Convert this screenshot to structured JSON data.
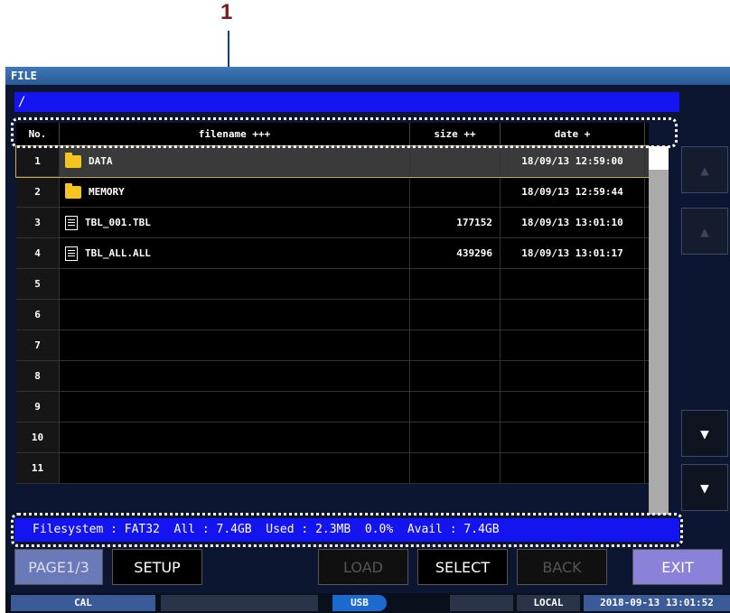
{
  "callout": {
    "number": "1"
  },
  "window": {
    "title": "FILE"
  },
  "path": "/",
  "table": {
    "headers": {
      "no": "No.",
      "filename": "filename +++",
      "size": "size ++",
      "date": "date +"
    },
    "rows": [
      {
        "no": "1",
        "icon": "folder-icon",
        "name": "DATA",
        "size": "",
        "date": "18/09/13 12:59:00",
        "selected": true
      },
      {
        "no": "2",
        "icon": "folder-icon",
        "name": "MEMORY",
        "size": "",
        "date": "18/09/13 12:59:44"
      },
      {
        "no": "3",
        "icon": "file-icon",
        "name": "TBL_001.TBL",
        "size": "177152",
        "date": "18/09/13 13:01:10"
      },
      {
        "no": "4",
        "icon": "file-icon",
        "name": "TBL_ALL.ALL",
        "size": "439296",
        "date": "18/09/13 13:01:17"
      },
      {
        "no": "5",
        "icon": "",
        "name": "",
        "size": "",
        "date": ""
      },
      {
        "no": "6",
        "icon": "",
        "name": "",
        "size": "",
        "date": ""
      },
      {
        "no": "7",
        "icon": "",
        "name": "",
        "size": "",
        "date": ""
      },
      {
        "no": "8",
        "icon": "",
        "name": "",
        "size": "",
        "date": ""
      },
      {
        "no": "9",
        "icon": "",
        "name": "",
        "size": "",
        "date": ""
      },
      {
        "no": "10",
        "icon": "",
        "name": "",
        "size": "",
        "date": ""
      },
      {
        "no": "11",
        "icon": "",
        "name": "",
        "size": "",
        "date": ""
      }
    ]
  },
  "filesystem": "Filesystem : FAT32  All : 7.4GB  Used : 2.3MB  0.0%  Avail : 7.4GB",
  "buttons": {
    "page": "PAGE1/3",
    "setup": "SETUP",
    "load": "LOAD",
    "select": "SELECT",
    "back": "BACK",
    "exit": "EXIT"
  },
  "side_buttons": {
    "page_up": "▲",
    "up": "▲",
    "down": "▼",
    "page_down": "▼"
  },
  "footer": {
    "cal": "CAL",
    "usb": "USB",
    "local": "LOCAL",
    "datetime": "2018-09-13 13:01:52"
  },
  "colors": {
    "path_bar": "#1414f0",
    "status_bar": "#1414f0",
    "folder": "#f4c420",
    "callout": "#7a1a1a",
    "callout_line": "#0b3f86"
  }
}
